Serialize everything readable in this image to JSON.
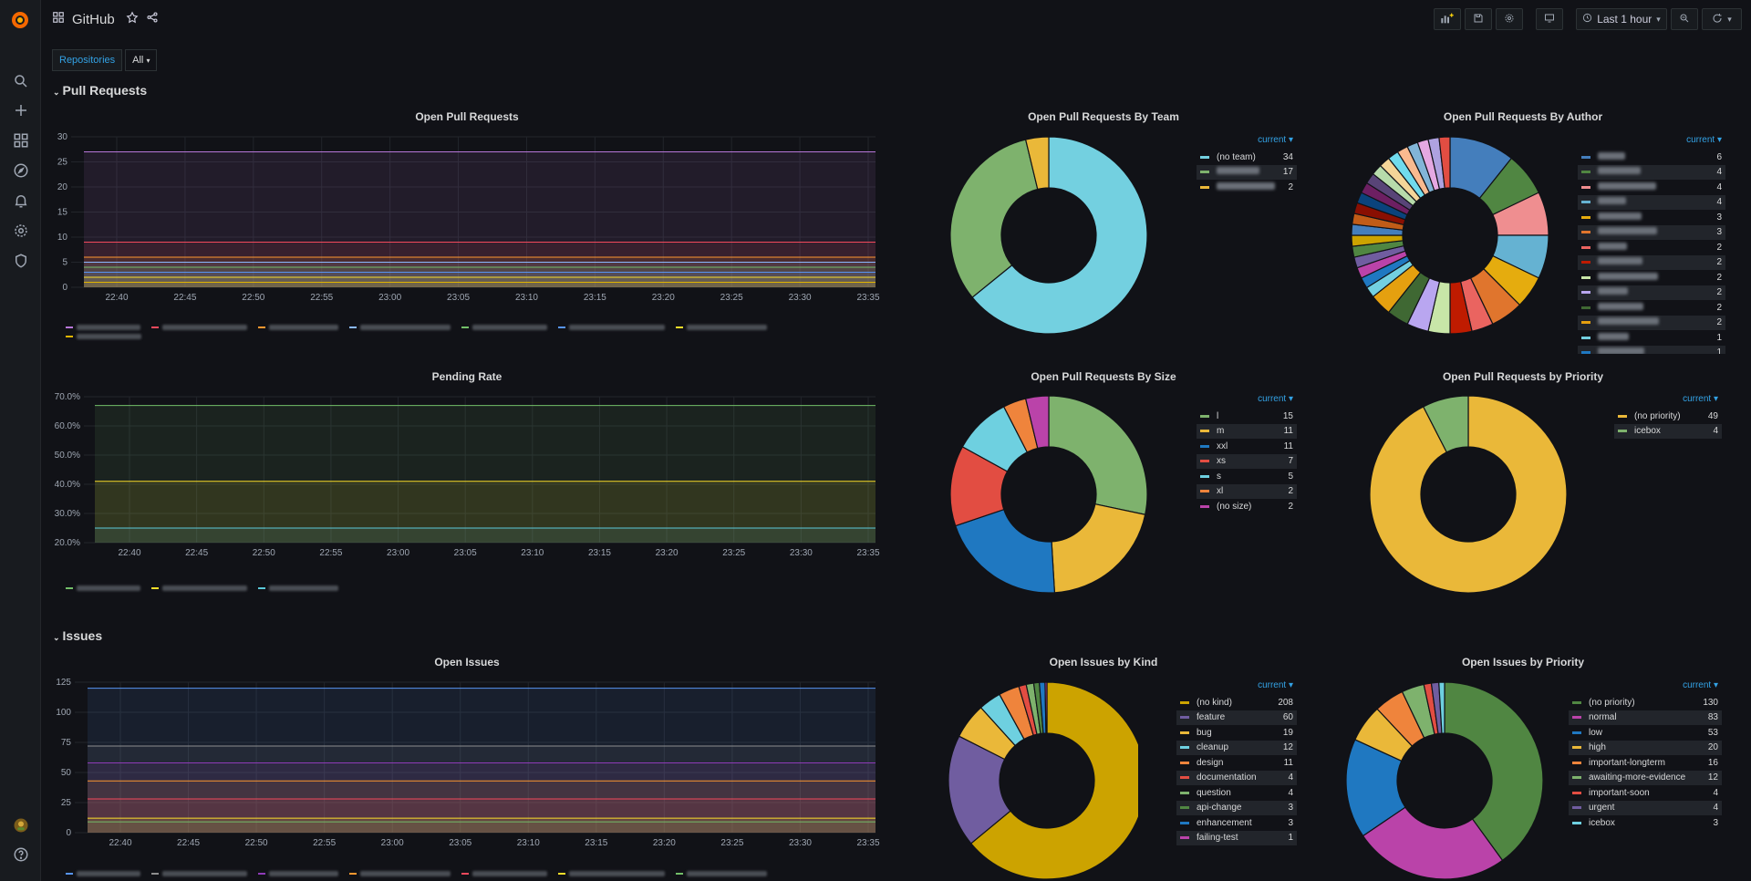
{
  "app": {
    "title": "GitHub"
  },
  "toolbar": {
    "time_range": "Last 1 hour"
  },
  "variables": {
    "label": "Repositories",
    "value": "All"
  },
  "rows": {
    "pull_requests": "Pull Requests",
    "issues": "Issues"
  },
  "time_ticks": [
    "22:40",
    "22:45",
    "22:50",
    "22:55",
    "23:00",
    "23:05",
    "23:10",
    "23:15",
    "23:20",
    "23:25",
    "23:30",
    "23:35"
  ],
  "legend_header": "current",
  "colors": {
    "accent": "#33a2e5",
    "bg": "#111217"
  },
  "panels": {
    "open_prs": {
      "title": "Open Pull Requests",
      "y_ticks": [
        "0",
        "5",
        "10",
        "15",
        "20",
        "25",
        "30"
      ]
    },
    "pending_rate": {
      "title": "Pending Rate",
      "y_ticks": [
        "20.0%",
        "30.0%",
        "40.0%",
        "50.0%",
        "60.0%",
        "70.0%"
      ]
    },
    "open_issues": {
      "title": "Open Issues",
      "y_ticks": [
        "0",
        "25",
        "50",
        "75",
        "100",
        "125"
      ]
    },
    "prs_by_team": {
      "title": "Open Pull Requests By Team"
    },
    "prs_by_author": {
      "title": "Open Pull Requests By Author"
    },
    "prs_by_size": {
      "title": "Open Pull Requests By Size"
    },
    "prs_by_priority": {
      "title": "Open Pull Requests by Priority"
    },
    "issues_by_kind": {
      "title": "Open Issues by Kind"
    },
    "issues_by_priority": {
      "title": "Open Issues by Priority"
    }
  },
  "chart_data": [
    {
      "type": "area",
      "title": "Open Pull Requests",
      "ylim": [
        0,
        30
      ],
      "series": [
        {
          "values": [
            27
          ]
        },
        {
          "values": [
            9
          ]
        },
        {
          "values": [
            6
          ]
        },
        {
          "values": [
            5
          ]
        },
        {
          "values": [
            4
          ]
        },
        {
          "values": [
            3
          ]
        },
        {
          "values": [
            2
          ]
        },
        {
          "values": [
            1
          ]
        }
      ]
    },
    {
      "type": "area",
      "title": "Pending Rate",
      "ylim": [
        20,
        70
      ],
      "series": [
        {
          "values": [
            67
          ]
        },
        {
          "values": [
            41
          ]
        },
        {
          "values": [
            25
          ]
        }
      ]
    },
    {
      "type": "area",
      "title": "Open Issues",
      "ylim": [
        0,
        125
      ],
      "series": [
        {
          "values": [
            120
          ]
        },
        {
          "values": [
            72
          ]
        },
        {
          "values": [
            58
          ]
        },
        {
          "values": [
            43
          ]
        },
        {
          "values": [
            28
          ]
        },
        {
          "values": [
            12
          ]
        },
        {
          "values": [
            9
          ]
        }
      ]
    },
    {
      "type": "pie",
      "title": "Open Pull Requests By Team",
      "slices": [
        {
          "label": "(no team)",
          "value": 34,
          "color": "#73d0e0"
        },
        {
          "label": "",
          "value": 17,
          "color": "#7eb26d"
        },
        {
          "label": "",
          "value": 2,
          "color": "#eab839"
        }
      ]
    },
    {
      "type": "pie",
      "title": "Open Pull Requests By Author",
      "slices": [
        {
          "label": "",
          "value": 6,
          "color": "#447ebc"
        },
        {
          "label": "",
          "value": 4,
          "color": "#508642"
        },
        {
          "label": "",
          "value": 4,
          "color": "#ef8e90"
        },
        {
          "label": "",
          "value": 4,
          "color": "#65b2d2"
        },
        {
          "label": "",
          "value": 3,
          "color": "#e5ac0e"
        },
        {
          "label": "",
          "value": 3,
          "color": "#e0752d"
        },
        {
          "label": "",
          "value": 2,
          "color": "#ea6460"
        },
        {
          "label": "",
          "value": 2,
          "color": "#bf1b00"
        },
        {
          "label": "",
          "value": 2,
          "color": "#c8e6a8"
        },
        {
          "label": "",
          "value": 2,
          "color": "#b9a6f0"
        },
        {
          "label": "",
          "value": 2,
          "color": "#3f6833"
        },
        {
          "label": "",
          "value": 2,
          "color": "#e5a00f"
        },
        {
          "label": "",
          "value": 1,
          "color": "#73d0e0"
        },
        {
          "label": "",
          "value": 1,
          "color": "#1f78c1"
        },
        {
          "label": "",
          "value": 1,
          "color": "#ba43a9"
        },
        {
          "label": "",
          "value": 1,
          "color": "#705da0"
        },
        {
          "label": "",
          "value": 1,
          "color": "#508642"
        },
        {
          "label": "",
          "value": 1,
          "color": "#cca300"
        },
        {
          "label": "",
          "value": 1,
          "color": "#447ebc"
        },
        {
          "label": "",
          "value": 1,
          "color": "#c15c17"
        },
        {
          "label": "",
          "value": 1,
          "color": "#890f02"
        },
        {
          "label": "",
          "value": 1,
          "color": "#0a437c"
        },
        {
          "label": "",
          "value": 1,
          "color": "#6d1f62"
        },
        {
          "label": "",
          "value": 1,
          "color": "#584477"
        },
        {
          "label": "",
          "value": 1,
          "color": "#b7dbab"
        },
        {
          "label": "",
          "value": 1,
          "color": "#f4d598"
        },
        {
          "label": "",
          "value": 1,
          "color": "#70dbed"
        },
        {
          "label": "",
          "value": 1,
          "color": "#f9ba8f"
        },
        {
          "label": "",
          "value": 1,
          "color": "#82b5d8"
        },
        {
          "label": "",
          "value": 1,
          "color": "#e5a8e2"
        },
        {
          "label": "",
          "value": 1,
          "color": "#aea2e0"
        },
        {
          "label": "",
          "value": 1,
          "color": "#e24d42"
        }
      ]
    },
    {
      "type": "pie",
      "title": "Open Pull Requests By Size",
      "slices": [
        {
          "label": "l",
          "value": 15,
          "color": "#7eb26d"
        },
        {
          "label": "m",
          "value": 11,
          "color": "#eab839"
        },
        {
          "label": "xxl",
          "value": 11,
          "color": "#1f78c1"
        },
        {
          "label": "xs",
          "value": 7,
          "color": "#e24d42"
        },
        {
          "label": "s",
          "value": 5,
          "color": "#6ed0e0"
        },
        {
          "label": "xl",
          "value": 2,
          "color": "#ef843c"
        },
        {
          "label": "(no size)",
          "value": 2,
          "color": "#ba43a9"
        }
      ]
    },
    {
      "type": "pie",
      "title": "Open Pull Requests by Priority",
      "slices": [
        {
          "label": "(no priority)",
          "value": 49,
          "color": "#eab839"
        },
        {
          "label": "icebox",
          "value": 4,
          "color": "#7eb26d"
        }
      ]
    },
    {
      "type": "pie",
      "title": "Open Issues by Kind",
      "slices": [
        {
          "label": "(no kind)",
          "value": 208,
          "color": "#cca300"
        },
        {
          "label": "feature",
          "value": 60,
          "color": "#705da0"
        },
        {
          "label": "bug",
          "value": 19,
          "color": "#eab839"
        },
        {
          "label": "cleanup",
          "value": 12,
          "color": "#6ed0e0"
        },
        {
          "label": "design",
          "value": 11,
          "color": "#ef843c"
        },
        {
          "label": "documentation",
          "value": 4,
          "color": "#e24d42"
        },
        {
          "label": "question",
          "value": 4,
          "color": "#7eb26d"
        },
        {
          "label": "api-change",
          "value": 3,
          "color": "#508642"
        },
        {
          "label": "enhancement",
          "value": 3,
          "color": "#1f78c1"
        },
        {
          "label": "failing-test",
          "value": 1,
          "color": "#ba43a9"
        }
      ]
    },
    {
      "type": "pie",
      "title": "Open Issues by Priority",
      "slices": [
        {
          "label": "(no priority)",
          "value": 130,
          "color": "#508642"
        },
        {
          "label": "normal",
          "value": 83,
          "color": "#ba43a9"
        },
        {
          "label": "low",
          "value": 53,
          "color": "#1f78c1"
        },
        {
          "label": "high",
          "value": 20,
          "color": "#eab839"
        },
        {
          "label": "important-longterm",
          "value": 16,
          "color": "#ef843c"
        },
        {
          "label": "awaiting-more-evidence",
          "value": 12,
          "color": "#7eb26d"
        },
        {
          "label": "important-soon",
          "value": 4,
          "color": "#e24d42"
        },
        {
          "label": "urgent",
          "value": 4,
          "color": "#705da0"
        },
        {
          "label": "icebox",
          "value": 3,
          "color": "#6ed0e0"
        }
      ]
    }
  ]
}
